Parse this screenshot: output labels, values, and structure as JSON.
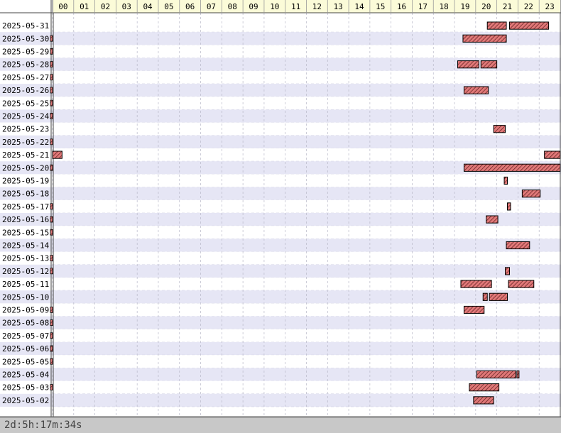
{
  "chart_data": {
    "type": "gantt",
    "title": "",
    "xlabel": "",
    "ylabel": "",
    "x_unit": "hour",
    "xlim": [
      0,
      24
    ],
    "hours": [
      "00",
      "01",
      "02",
      "03",
      "04",
      "05",
      "06",
      "07",
      "08",
      "09",
      "10",
      "11",
      "12",
      "13",
      "14",
      "15",
      "16",
      "17",
      "18",
      "19",
      "20",
      "21",
      "22",
      "23"
    ],
    "dates": [
      "2025-05-31",
      "2025-05-30",
      "2025-05-29",
      "2025-05-28",
      "2025-05-27",
      "2025-05-26",
      "2025-05-25",
      "2025-05-24",
      "2025-05-23",
      "2025-05-22",
      "2025-05-21",
      "2025-05-20",
      "2025-05-19",
      "2025-05-18",
      "2025-05-17",
      "2025-05-16",
      "2025-05-15",
      "2025-05-14",
      "2025-05-13",
      "2025-05-12",
      "2025-05-11",
      "2025-05-10",
      "2025-05-09",
      "2025-05-08",
      "2025-05-07",
      "2025-05-06",
      "2025-05-05",
      "2025-05-04",
      "2025-05-03",
      "2025-05-02"
    ],
    "bars": [
      {
        "date": "2025-05-31",
        "start": 20.55,
        "end": 21.45
      },
      {
        "date": "2025-05-31",
        "start": 21.6,
        "end": 23.45
      },
      {
        "date": "2025-05-30",
        "start": 19.4,
        "end": 21.45
      },
      {
        "date": "2025-05-28",
        "start": 19.15,
        "end": 20.15
      },
      {
        "date": "2025-05-28",
        "start": 20.25,
        "end": 21.0
      },
      {
        "date": "2025-05-26",
        "start": 19.45,
        "end": 20.6
      },
      {
        "date": "2025-05-23",
        "start": 20.85,
        "end": 21.4
      },
      {
        "date": "2025-05-21",
        "start": 0.0,
        "end": 0.45
      },
      {
        "date": "2025-05-21",
        "start": 23.25,
        "end": 24.0
      },
      {
        "date": "2025-05-20",
        "start": 19.45,
        "end": 24.0
      },
      {
        "date": "2025-05-19",
        "start": 21.35,
        "end": 21.5
      },
      {
        "date": "2025-05-18",
        "start": 22.2,
        "end": 23.05
      },
      {
        "date": "2025-05-17",
        "start": 21.5,
        "end": 21.65
      },
      {
        "date": "2025-05-16",
        "start": 20.5,
        "end": 21.05
      },
      {
        "date": "2025-05-14",
        "start": 21.45,
        "end": 22.55
      },
      {
        "date": "2025-05-12",
        "start": 21.4,
        "end": 21.6
      },
      {
        "date": "2025-05-11",
        "start": 19.3,
        "end": 20.75
      },
      {
        "date": "2025-05-11",
        "start": 21.55,
        "end": 22.75
      },
      {
        "date": "2025-05-10",
        "start": 20.35,
        "end": 20.55
      },
      {
        "date": "2025-05-10",
        "start": 20.65,
        "end": 21.5
      },
      {
        "date": "2025-05-09",
        "start": 19.45,
        "end": 20.4
      },
      {
        "date": "2025-05-04",
        "start": 20.05,
        "end": 21.9
      },
      {
        "date": "2025-05-04",
        "start": 21.95,
        "end": 22.05
      },
      {
        "date": "2025-05-03",
        "start": 19.7,
        "end": 21.1
      },
      {
        "date": "2025-05-02",
        "start": 19.9,
        "end": 20.85
      }
    ],
    "ticks_at_origin": [
      "2025-05-30",
      "2025-05-29",
      "2025-05-28",
      "2025-05-27",
      "2025-05-26",
      "2025-05-25",
      "2025-05-24",
      "2025-05-22",
      "2025-05-20",
      "2025-05-17",
      "2025-05-16",
      "2025-05-15",
      "2025-05-13",
      "2025-05-12",
      "2025-05-09",
      "2025-05-08",
      "2025-05-07",
      "2025-05-06",
      "2025-05-05",
      "2025-05-03"
    ],
    "colors": {
      "bar_fill": "#e07878",
      "bar_stroke": "#000000",
      "row_alt": "#e6e6f5",
      "header_bg": "#fbfbd8",
      "grid": "#b8b8c8"
    }
  },
  "footer": {
    "duration": "2d:5h:17m:34s"
  }
}
